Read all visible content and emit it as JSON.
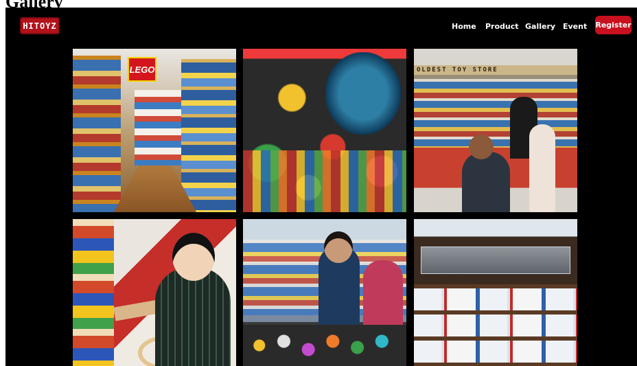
{
  "page": {
    "heading": "Gallery"
  },
  "brand": {
    "logo_text": "HITOYZ",
    "accent": "#c8101e"
  },
  "nav": {
    "items": [
      {
        "label": "Home"
      },
      {
        "label": "Product"
      },
      {
        "label": "Gallery"
      },
      {
        "label": "Event"
      }
    ],
    "register_label": "Register"
  },
  "gallery": {
    "photos": [
      {
        "name": "lego-store-aisle",
        "sign_text": "LEGO"
      },
      {
        "name": "colorful-toy-store"
      },
      {
        "name": "oldest-toy-store",
        "banner_text": "OLDEST TOY STORE"
      },
      {
        "name": "boy-with-toy"
      },
      {
        "name": "woman-in-toy-store"
      },
      {
        "name": "model-car-shelves"
      }
    ]
  }
}
